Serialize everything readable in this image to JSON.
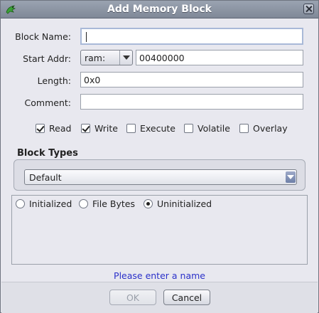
{
  "window": {
    "title": "Add Memory Block"
  },
  "form": {
    "block_name": {
      "label": "Block Name:",
      "value": ""
    },
    "start_addr": {
      "label": "Start Addr:",
      "space": "ram:",
      "value": "00400000"
    },
    "length": {
      "label": "Length:",
      "value": "0x0"
    },
    "comment": {
      "label": "Comment:",
      "value": ""
    }
  },
  "permissions": [
    {
      "label": "Read",
      "checked": true
    },
    {
      "label": "Write",
      "checked": true
    },
    {
      "label": "Execute",
      "checked": false
    },
    {
      "label": "Volatile",
      "checked": false
    },
    {
      "label": "Overlay",
      "checked": false
    }
  ],
  "block_types": {
    "heading": "Block Types",
    "selected": "Default"
  },
  "initialization": [
    {
      "label": "Initialized",
      "selected": false
    },
    {
      "label": "File Bytes",
      "selected": false
    },
    {
      "label": "Uninitialized",
      "selected": true
    }
  ],
  "status_message": "Please enter a name",
  "buttons": {
    "ok": "OK",
    "cancel": "Cancel"
  }
}
